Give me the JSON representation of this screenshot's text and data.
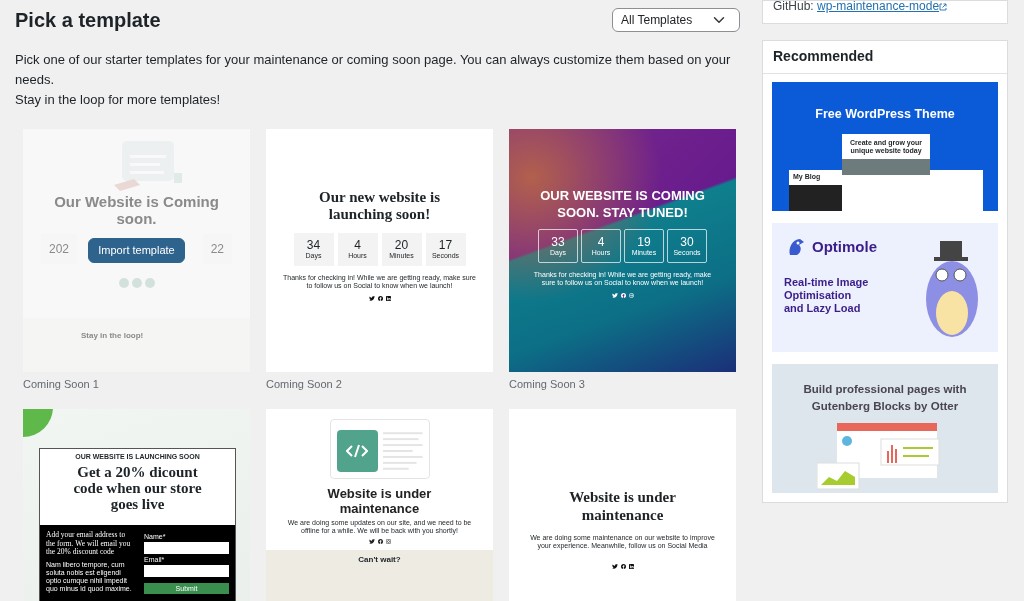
{
  "header": {
    "title": "Pick a template",
    "filter": {
      "value": "All Templates"
    }
  },
  "intro": [
    "Pick one of our starter templates for your maintenance or coming soon page. You can always customize them based on your needs.",
    "Stay in the loop for more templates!"
  ],
  "templates": [
    {
      "kind": "illustrated",
      "name": "Coming Soon 1",
      "hovered": true,
      "action": "Import template",
      "title": "Our Website is Coming soon.",
      "counters": [
        "202",
        "22"
      ],
      "footer_title": "Stay in the loop!"
    },
    {
      "kind": "countdown",
      "name": "Coming Soon 2",
      "hovered": false,
      "title": "Our new website is launching soon!",
      "counters": [
        {
          "value": "34",
          "unit": "Days"
        },
        {
          "value": "4",
          "unit": "Hours"
        },
        {
          "value": "20",
          "unit": "Minutes"
        },
        {
          "value": "17",
          "unit": "Seconds"
        }
      ],
      "text": "Thanks for checking in! While we are getting ready, make sure to follow us on Social to know when we launch!"
    },
    {
      "kind": "gradient",
      "name": "Coming Soon 3",
      "hovered": false,
      "title": "OUR WEBSITE IS COMING SOON. STAY TUNED!",
      "counters": [
        {
          "value": "33",
          "unit": "Days"
        },
        {
          "value": "4",
          "unit": "Hours"
        },
        {
          "value": "19",
          "unit": "Minutes"
        },
        {
          "value": "30",
          "unit": "Seconds"
        }
      ],
      "text": "Thanks for checking in! While we are getting ready, make sure to follow us on Social to know when we launch!"
    },
    {
      "kind": "discount",
      "hovered": false,
      "eyebrow": "OUR WEBSITE IS LAUNCHING SOON",
      "title": "Get a 20% dicount code when our store goes live",
      "lead": "Add your email address to the form. We will email you the 20% discount code",
      "text": "Nam libero tempore, cum soluta nobis est eligendi optio cumque nihil impedit quo minus id quod maxime.",
      "fields": [
        {
          "label": "Name*"
        },
        {
          "label": "Email*"
        }
      ],
      "submit": "Submit"
    },
    {
      "kind": "maintenance-art",
      "hovered": false,
      "title": "Website is under maintenance",
      "text": "We are doing some updates on our site, and we need to be offline for a while. We will be back with you shortly!",
      "footer_title": "Can't wait?"
    },
    {
      "kind": "maintenance",
      "hovered": false,
      "title": "Website is under maintenance",
      "text": "We are doing some maintenance on our website to improve your experience. Meanwhile, follow us on Social Media"
    }
  ],
  "sidebar": {
    "github": {
      "label": "GitHub:",
      "link": "wp-maintenance-mode"
    },
    "recommended": {
      "title": "Recommended",
      "banners": [
        {
          "kind": "theme",
          "title": "Free WordPress Theme",
          "mock_heading": "Create and grow your unique website today",
          "mock_blog": "My Blog"
        },
        {
          "kind": "optimole",
          "brand": "Optimole",
          "title": "Real-time Image Optimisation and Lazy Load"
        },
        {
          "kind": "otter",
          "title": "Build professional pages with Gutenberg Blocks by Otter"
        }
      ]
    }
  }
}
